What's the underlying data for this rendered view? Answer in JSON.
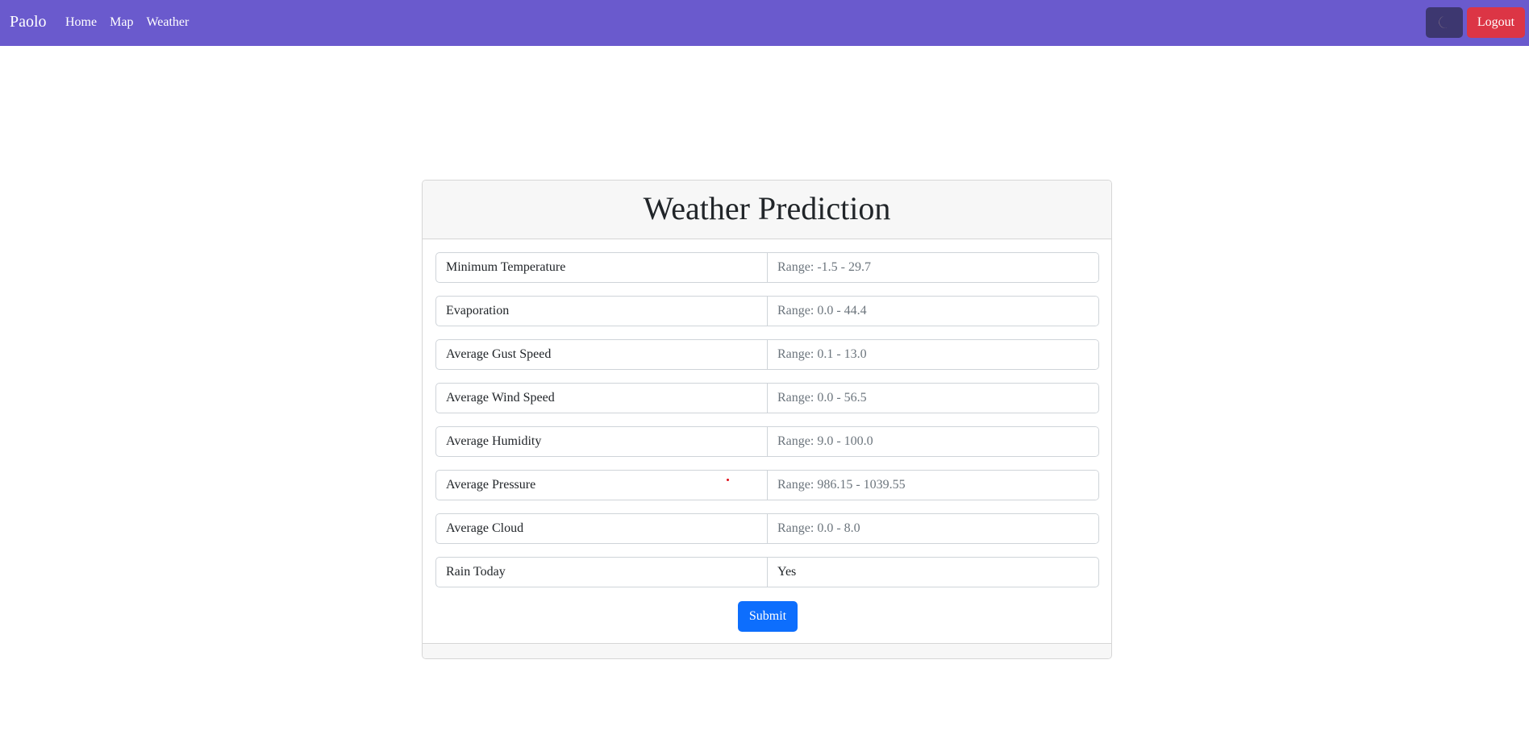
{
  "navbar": {
    "brand": "Paolo",
    "links": [
      {
        "label": "Home"
      },
      {
        "label": "Map"
      },
      {
        "label": "Weather"
      }
    ],
    "logout_label": "Logout",
    "theme_icon": "moon-icon"
  },
  "card": {
    "title": "Weather Prediction",
    "fields": [
      {
        "label": "Minimum Temperature",
        "placeholder": "Range: -1.5 - 29.7"
      },
      {
        "label": "Evaporation",
        "placeholder": "Range: 0.0 - 44.4"
      },
      {
        "label": "Average Gust Speed",
        "placeholder": "Range: 0.1 - 13.0"
      },
      {
        "label": "Average Wind Speed",
        "placeholder": "Range: 0.0 - 56.5"
      },
      {
        "label": "Average Humidity",
        "placeholder": "Range: 9.0 - 100.0"
      },
      {
        "label": "Average Pressure",
        "placeholder": "Range: 986.15 - 1039.55"
      },
      {
        "label": "Average Cloud",
        "placeholder": "Range: 0.0 - 8.0"
      }
    ],
    "rain_today": {
      "label": "Rain Today",
      "value": "Yes"
    },
    "submit_label": "Submit"
  },
  "colors": {
    "navbar": "#6a5acd",
    "logout": "#dc3545",
    "submit": "#0d6efd"
  }
}
